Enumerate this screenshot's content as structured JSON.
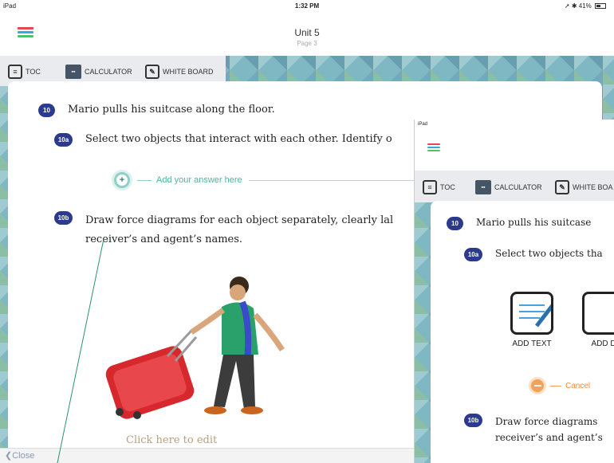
{
  "status": {
    "device": "iPad",
    "time": "1:32 PM",
    "battery": "41%"
  },
  "header": {
    "title": "Unit 5",
    "subtitle": "Page 3"
  },
  "toolbar": {
    "toc": "TOC",
    "calculator": "CALCULATOR",
    "whiteboard": "WHITE BOARD"
  },
  "question": {
    "number": "10",
    "text": "Mario pulls his suitcase along the floor.",
    "parts": [
      {
        "label": "10a",
        "text": "Select two objects that interact with each other. Identify o"
      },
      {
        "label": "10b",
        "line1": "Draw force diagrams for each object separately, clearly lal",
        "line2": "receiver’s and agent’s names."
      }
    ]
  },
  "answer": {
    "placeholder": "Add your answer here"
  },
  "click_text": "Click here to edit",
  "close_label": "Close",
  "inset": {
    "status": {
      "device": "iPad"
    },
    "toolbar": {
      "toc": "TOC",
      "calculator": "CALCULATOR",
      "whiteboard": "WHITE BOA"
    },
    "question": {
      "number": "10",
      "text": "Mario pulls his suitcase",
      "part_a": {
        "label": "10a",
        "text": "Select two objects tha"
      },
      "part_b": {
        "label": "10b",
        "line1": "Draw force diagrams",
        "line2": "receiver’s and agent’s"
      }
    },
    "add_text": "ADD TEXT",
    "add_drawing": "ADD D",
    "cancel": "Cancel"
  },
  "colors": {
    "badge": "#2b3a8c",
    "accent_teal": "#4fb3a4",
    "accent_orange": "#f08c3a"
  }
}
